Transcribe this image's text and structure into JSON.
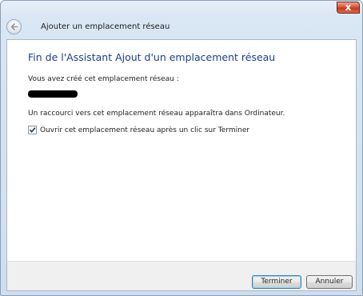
{
  "window": {
    "title": "Ajouter un emplacement réseau",
    "close_glyph": "x"
  },
  "main": {
    "heading": "Fin de l'Assistant Ajout d'un emplacement réseau",
    "intro": "Vous avez créé cet emplacement réseau :",
    "location_name": "",
    "info": "Un raccourci vers cet emplacement réseau apparaîtra dans Ordinateur.",
    "open_checkbox": {
      "checked": true,
      "label": "Ouvrir cet emplacement réseau après un clic sur Terminer"
    }
  },
  "footer": {
    "finish_label": "Terminer",
    "cancel_label": "Annuler"
  },
  "icons": {
    "back": "back-arrow-icon",
    "close": "close-icon",
    "check": "checkmark-icon"
  },
  "colors": {
    "heading": "#1d3d8c",
    "frame": "#cfdeee",
    "close_button": "#c23a1c"
  }
}
